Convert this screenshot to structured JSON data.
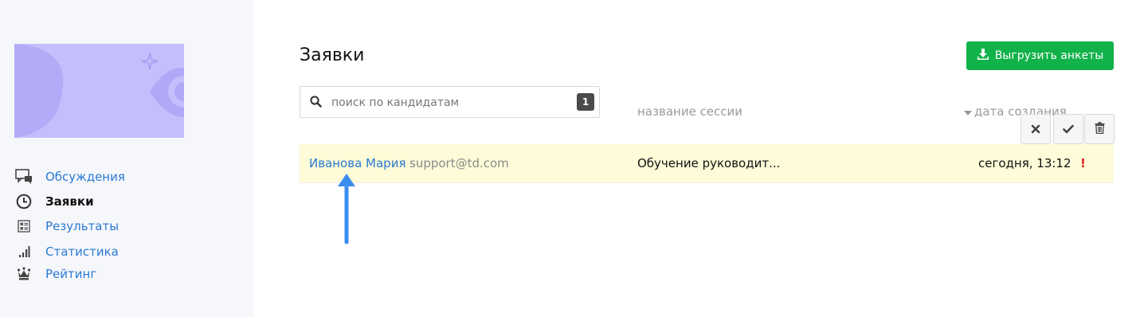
{
  "sidebar": {
    "items": [
      {
        "label": "Обсуждения",
        "icon": "chat-icon",
        "active": false
      },
      {
        "label": "Заявки",
        "icon": "clock-icon",
        "active": true
      },
      {
        "label": "Результаты",
        "icon": "results-icon",
        "active": false
      },
      {
        "label": "Статистика",
        "icon": "bar-chart-icon",
        "active": false
      },
      {
        "label": "Рейтинг",
        "icon": "crown-icon",
        "active": false
      }
    ]
  },
  "main": {
    "title": "Заявки",
    "export_label": "Выгрузить анкеты",
    "search": {
      "placeholder": "поиск по кандидатам",
      "value": "",
      "count": "1"
    },
    "columns": {
      "session": "название сессии",
      "date": "дата создания"
    },
    "rows": [
      {
        "name": "Иванова Мария",
        "email": "support@td.com",
        "session": "Обучение руководит...",
        "date": "сегодня, 13:12",
        "flag": "!"
      }
    ]
  },
  "colors": {
    "accent_link": "#2a7ad2",
    "primary_button": "#12b24a",
    "row_highlight": "#fdfbd8",
    "alert": "#e02020",
    "annotation_arrow": "#3b8ef0"
  }
}
